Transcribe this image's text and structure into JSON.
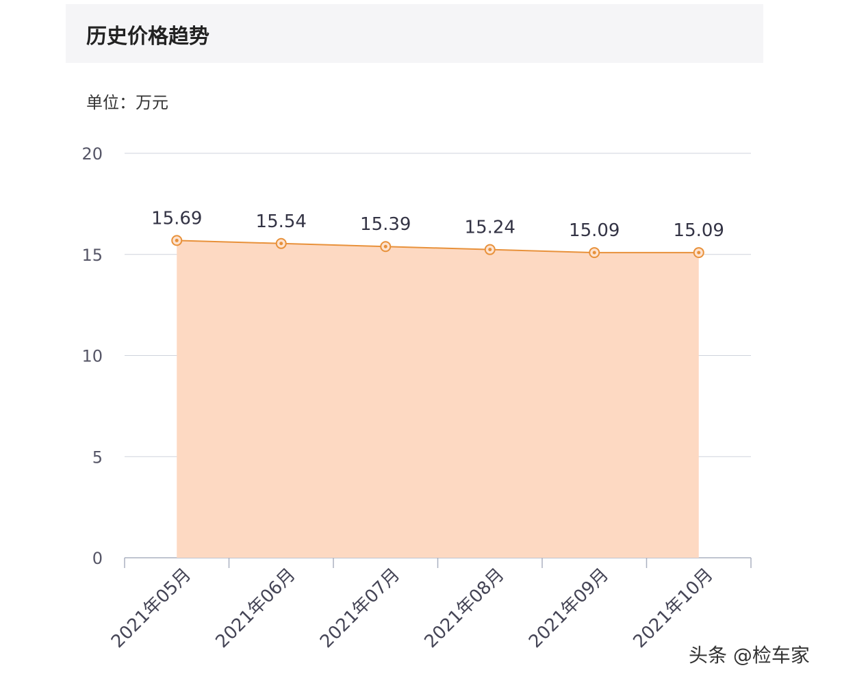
{
  "header": {
    "title": "历史价格趋势"
  },
  "unit_label": "单位：万元",
  "watermark": "头条 @检车家",
  "chart_data": {
    "type": "area",
    "categories": [
      "2021年05月",
      "2021年06月",
      "2021年07月",
      "2021年08月",
      "2021年09月",
      "2021年10月"
    ],
    "series": [
      {
        "values": [
          15.69,
          15.54,
          15.39,
          15.24,
          15.09,
          15.09
        ]
      }
    ],
    "data_labels": [
      "15.69",
      "15.54",
      "15.39",
      "15.24",
      "15.09",
      "15.09"
    ],
    "ylim": [
      0,
      20
    ],
    "yticks": [
      "0",
      "5",
      "10",
      "15",
      "20"
    ],
    "grid": true,
    "colors": {
      "line": "#e8913a",
      "fill": "#fdd9c2",
      "grid": "#cfd3dc",
      "tick": "#555566"
    }
  }
}
